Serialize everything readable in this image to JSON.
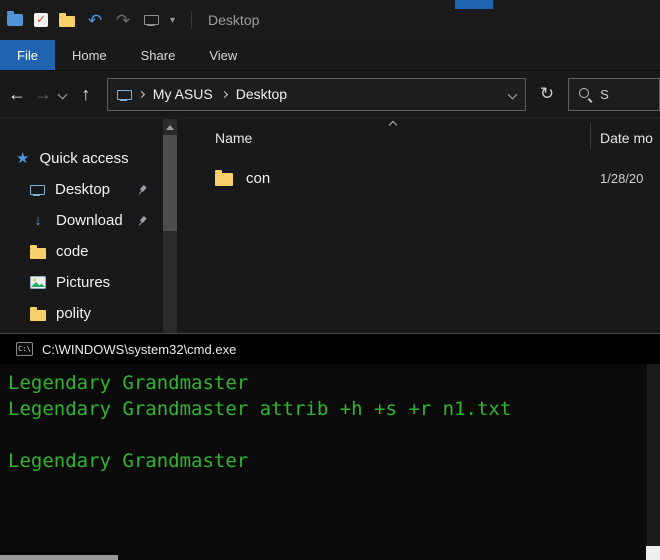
{
  "colors": {
    "accent": "#1f64b0",
    "folder": "#f7d06a",
    "cmdgreen": "#2eb62e",
    "pin": "#9aa0a6"
  },
  "explorer": {
    "titlebar": {
      "title": "Desktop"
    },
    "ribbon": {
      "tabs": [
        {
          "label": "File"
        },
        {
          "label": "Home"
        },
        {
          "label": "Share"
        },
        {
          "label": "View"
        }
      ]
    },
    "navbar": {
      "crumbs": [
        "My ASUS",
        "Desktop"
      ],
      "search_placeholder": "S"
    },
    "sidebar": {
      "items": [
        {
          "label": "Quick access"
        },
        {
          "label": "Desktop"
        },
        {
          "label": "Download"
        },
        {
          "label": "code"
        },
        {
          "label": "Pictures"
        },
        {
          "label": "polity"
        }
      ]
    },
    "content": {
      "columns": {
        "name": "Name",
        "date": "Date mo"
      },
      "rows": [
        {
          "name": "con",
          "date": "1/28/20"
        }
      ]
    }
  },
  "cmd": {
    "icon_glyph": "C:\\",
    "title": "C:\\WINDOWS\\system32\\cmd.exe",
    "lines": [
      "Legendary Grandmaster",
      "Legendary Grandmaster attrib +h +s +r n1.txt",
      "",
      "Legendary Grandmaster"
    ]
  }
}
